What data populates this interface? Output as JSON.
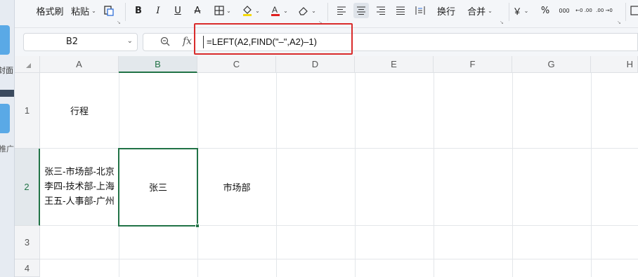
{
  "side_panel": {
    "label_top": "封面",
    "label_bottom": "推广"
  },
  "ribbon": {
    "format_painter": "格式刷",
    "paste": "粘贴",
    "wrap_text": "换行",
    "merge": "合并",
    "currency_symbol": "￥",
    "percent_symbol": "%",
    "thousands_symbol": "000",
    "decimal_inc": "←0 .00",
    "decimal_dec": ".00 →0"
  },
  "formula_bar": {
    "name_box": "B2",
    "fx": "fx",
    "formula": "=LEFT(A2,FIND(\"–\",A2)–1)"
  },
  "columns": [
    "A",
    "B",
    "C",
    "D",
    "E",
    "F",
    "G",
    "H"
  ],
  "rows": [
    "1",
    "2",
    "3",
    "4"
  ],
  "cells": {
    "A1": "行程",
    "A2": [
      "张三-市场部-北京",
      "李四-技术部-上海",
      "王五-人事部-广州"
    ],
    "B2": "张三",
    "C2": "市场部"
  },
  "selection": {
    "active_cell": "B2",
    "accent_color": "#217346"
  },
  "colors": {
    "highlight_box": "#d92b2b",
    "header_bg": "#f3f4f6"
  }
}
